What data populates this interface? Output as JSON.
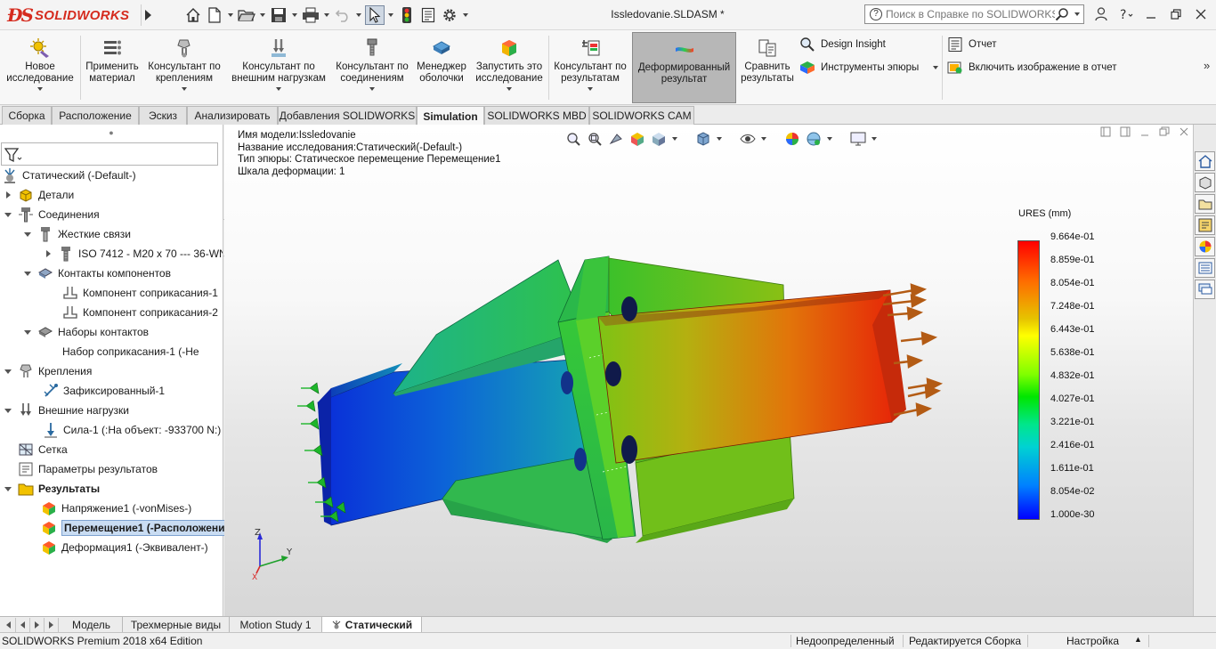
{
  "app": {
    "brand": "SOLIDWORKS",
    "document_title": "Issledovanie.SLDASM *",
    "search_placeholder": "Поиск в Справке по SOLIDWORKS"
  },
  "ribbon": {
    "buttons": [
      {
        "label": "Новое исследование",
        "icon": "new-study-icon"
      },
      {
        "label": "Применить материал",
        "icon": "apply-material-icon"
      },
      {
        "label": "Консультант по креплениям",
        "icon": "fixtures-advisor-icon"
      },
      {
        "label": "Консультант по внешним нагрузкам",
        "icon": "loads-advisor-icon"
      },
      {
        "label": "Консультант по соединениям",
        "icon": "connections-advisor-icon"
      },
      {
        "label": "Менеджер оболочки",
        "icon": "shell-manager-icon"
      },
      {
        "label": "Запустить это исследование",
        "icon": "run-study-icon"
      },
      {
        "label": "Консультант по результатам",
        "icon": "results-advisor-icon"
      },
      {
        "label": "Деформированный результат",
        "icon": "deformed-result-icon",
        "active": true
      },
      {
        "label": "Сравнить результаты",
        "icon": "compare-results-icon"
      }
    ],
    "small": [
      {
        "label": "Design Insight",
        "icon": "design-insight-icon"
      },
      {
        "label": "Инструменты эпюры",
        "icon": "plot-tools-icon"
      },
      {
        "label": "Отчет",
        "icon": "report-icon"
      },
      {
        "label": "Включить изображение в отчет",
        "icon": "include-image-icon"
      }
    ]
  },
  "command_tabs": [
    "Сборка",
    "Расположение",
    "Эскиз",
    "Анализировать",
    "Добавления SOLIDWORKS",
    "Simulation",
    "SOLIDWORKS MBD",
    "SOLIDWORKS CAM"
  ],
  "active_command_tab": "Simulation",
  "tree": {
    "root": "Статический (-Default-)",
    "items": [
      {
        "label": "Детали"
      },
      {
        "label": "Соединения"
      },
      {
        "label": "Жесткие связи"
      },
      {
        "label": "ISO 7412 - M20 x 70 --- 36-WN"
      },
      {
        "label": "Контакты компонентов"
      },
      {
        "label": "Компонент соприкасания-1"
      },
      {
        "label": "Компонент соприкасания-2"
      },
      {
        "label": "Наборы контактов"
      },
      {
        "label": "Набор соприкасания-1 (-Не"
      },
      {
        "label": "Крепления"
      },
      {
        "label": "Зафиксированный-1"
      },
      {
        "label": "Внешние нагрузки"
      },
      {
        "label": "Сила-1 (:На объект: -933700 N:)"
      },
      {
        "label": "Сетка"
      },
      {
        "label": "Параметры результатов"
      },
      {
        "label": "Результаты"
      },
      {
        "label": "Напряжение1 (-vonMises-)"
      },
      {
        "label": "Перемещение1 (-Расположени"
      },
      {
        "label": "Деформация1 (-Эквивалент-)"
      }
    ]
  },
  "graphics": {
    "info_lines": [
      "Имя модели:Issledovanie",
      "Название исследования:Статический(-Default-)",
      "Тип эпюры: Статическое перемещение Перемещение1",
      "Шкала деформации: 1"
    ],
    "legend": {
      "title": "URES (mm)",
      "labels": [
        "9.664e-01",
        "8.859e-01",
        "8.054e-01",
        "7.248e-01",
        "6.443e-01",
        "5.638e-01",
        "4.832e-01",
        "4.027e-01",
        "3.221e-01",
        "2.416e-01",
        "1.611e-01",
        "8.054e-02",
        "1.000e-30"
      ]
    },
    "triad": {
      "x": "X",
      "y": "Y",
      "z": "Z"
    }
  },
  "bottom_tabs": [
    "Модель",
    "Трехмерные виды",
    "Motion Study 1",
    "Статический"
  ],
  "active_bottom_tab": "Статический",
  "status": {
    "edition": "SOLIDWORKS Premium 2018 x64 Edition",
    "definition": "Недоопределенный",
    "editing": "Редактируется Сборка",
    "settings": "Настройка"
  }
}
